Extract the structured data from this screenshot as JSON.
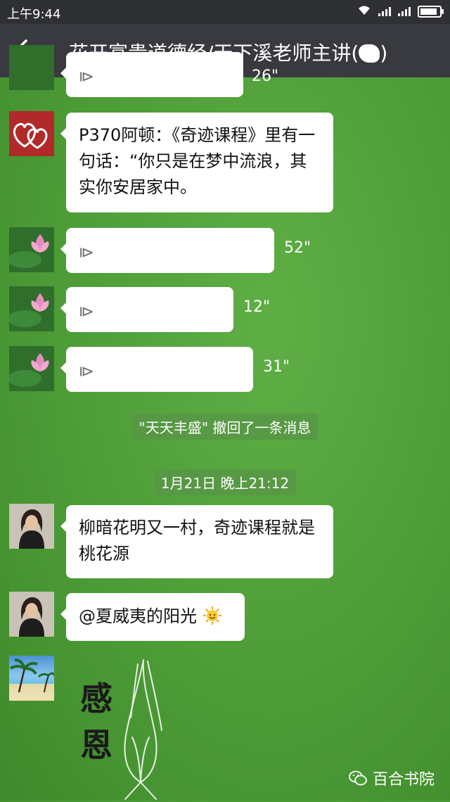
{
  "status_bar": {
    "time": "上午9:44"
  },
  "header": {
    "back_icon": "arrow-left-icon",
    "title": "花开富贵道德经/天下溪老师主讲(",
    "title_suffix": ")"
  },
  "messages": {
    "partial_duration": "26\"",
    "text_1": "P370阿顿：《奇迹课程》里有一句话：“你只是在梦中流浪，其实你安居家中。",
    "voice_1_duration": "52\"",
    "voice_2_duration": "12\"",
    "voice_3_duration": "31\"",
    "recall_notice": "\"天天丰盛\" 撤回了一条消息",
    "time_separator": "1月21日 晚上21:12",
    "text_2": "柳暗花明又一村，奇迹课程就是桃花源",
    "text_3": "@夏威夷的阳光",
    "sticker_text": "感恩"
  },
  "watermark": {
    "label": "百合书院"
  },
  "colors": {
    "chat_background": "#4d9c37",
    "header_bg": "#393a3f",
    "status_bg": "#2e3033"
  }
}
